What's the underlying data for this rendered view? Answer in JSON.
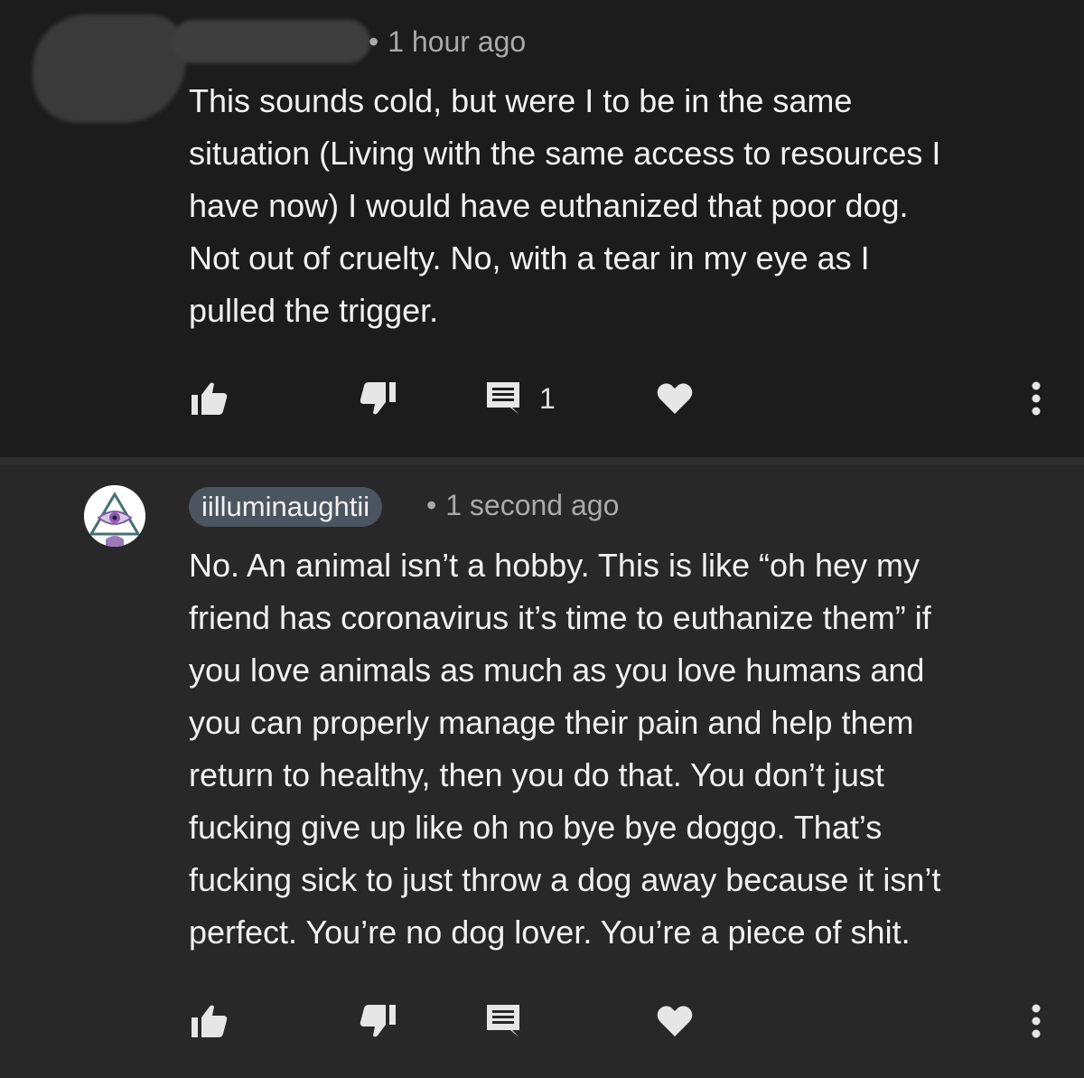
{
  "comments": [
    {
      "author": "",
      "timestamp": "1 hour ago",
      "body_lines": [
        "This sounds cold, but were I to be in the same",
        "situation (Living with the same access to resources I",
        "have now) I would have euthanized that poor dog.",
        "Not out of cruelty. No, with a tear in my eye as I",
        "pulled the trigger."
      ],
      "reply_count": "1",
      "actions": {
        "like_icon": "thumbs-up-icon",
        "dislike_icon": "thumbs-down-icon",
        "reply_icon": "comment-icon",
        "heart_icon": "heart-icon",
        "more_icon": "more-vertical-icon"
      }
    },
    {
      "author": "iilluminaughtii",
      "timestamp": "1 second ago",
      "body_lines": [
        "No. An animal isn’t a hobby. This is like “oh hey my",
        "friend has coronavirus it’s time to euthanize them” if",
        "you love animals as much as you love humans and",
        "you can properly manage their pain and help them",
        "return to healthy, then you do that. You don’t just",
        "fucking give up like oh no bye bye doggo. That’s",
        "fucking sick to just throw a dog away because it isn’t",
        "perfect. You’re no dog lover. You’re a piece of shit."
      ],
      "reply_count": "",
      "actions": {
        "like_icon": "thumbs-up-icon",
        "dislike_icon": "thumbs-down-icon",
        "reply_icon": "comment-icon",
        "heart_icon": "heart-icon",
        "more_icon": "more-vertical-icon"
      }
    }
  ],
  "colors": {
    "background_top": "#1c1c1c",
    "background_bottom": "#282828",
    "text_primary": "#f1f1f1",
    "text_secondary": "#aaaaaa",
    "username_chip": "#4a5560"
  }
}
